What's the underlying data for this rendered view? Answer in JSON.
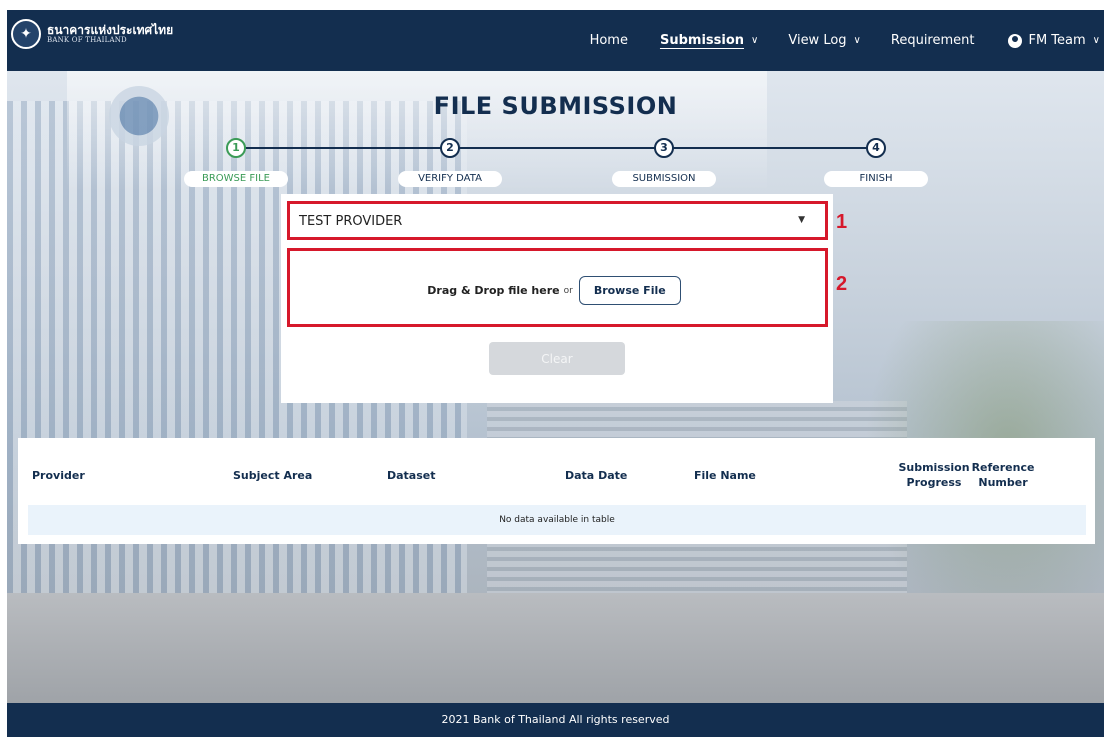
{
  "brand": {
    "name_thai": "ธนาคารแห่งประเทศไทย",
    "name_en": "BANK OF THAILAND"
  },
  "nav": {
    "home": "Home",
    "submission": "Submission",
    "view_log": "View Log",
    "requirement": "Requirement",
    "user": "FM Team"
  },
  "page": {
    "title": "FILE SUBMISSION"
  },
  "steps": [
    {
      "number": "1",
      "label": "BROWSE FILE",
      "status": "active"
    },
    {
      "number": "2",
      "label": "VERIFY DATA",
      "status": "pending"
    },
    {
      "number": "3",
      "label": "SUBMISSION",
      "status": "pending"
    },
    {
      "number": "4",
      "label": "FINISH",
      "status": "pending"
    }
  ],
  "upload": {
    "provider_value": "TEST PROVIDER",
    "dropzone_text": "Drag & Drop file here",
    "dropzone_or": "or",
    "browse_label": "Browse File",
    "clear_label": "Clear"
  },
  "annotations": [
    "1",
    "2"
  ],
  "table": {
    "columns": {
      "provider": "Provider",
      "subject_area": "Subject Area",
      "dataset": "Dataset",
      "data_date": "Data Date",
      "file_name": "File Name",
      "submission_progress_1": "Submission",
      "submission_progress_2": "Progress",
      "reference_number_1": "Reference",
      "reference_number_2": "Number"
    },
    "empty_message": "No data available in table"
  },
  "footer": {
    "text": "2021 Bank of Thailand All rights reserved"
  },
  "colors": {
    "navy": "#132e4f",
    "active_green": "#3b9b57",
    "annotation_red": "#d6182b",
    "empty_row_bg": "#eaf3fb"
  }
}
